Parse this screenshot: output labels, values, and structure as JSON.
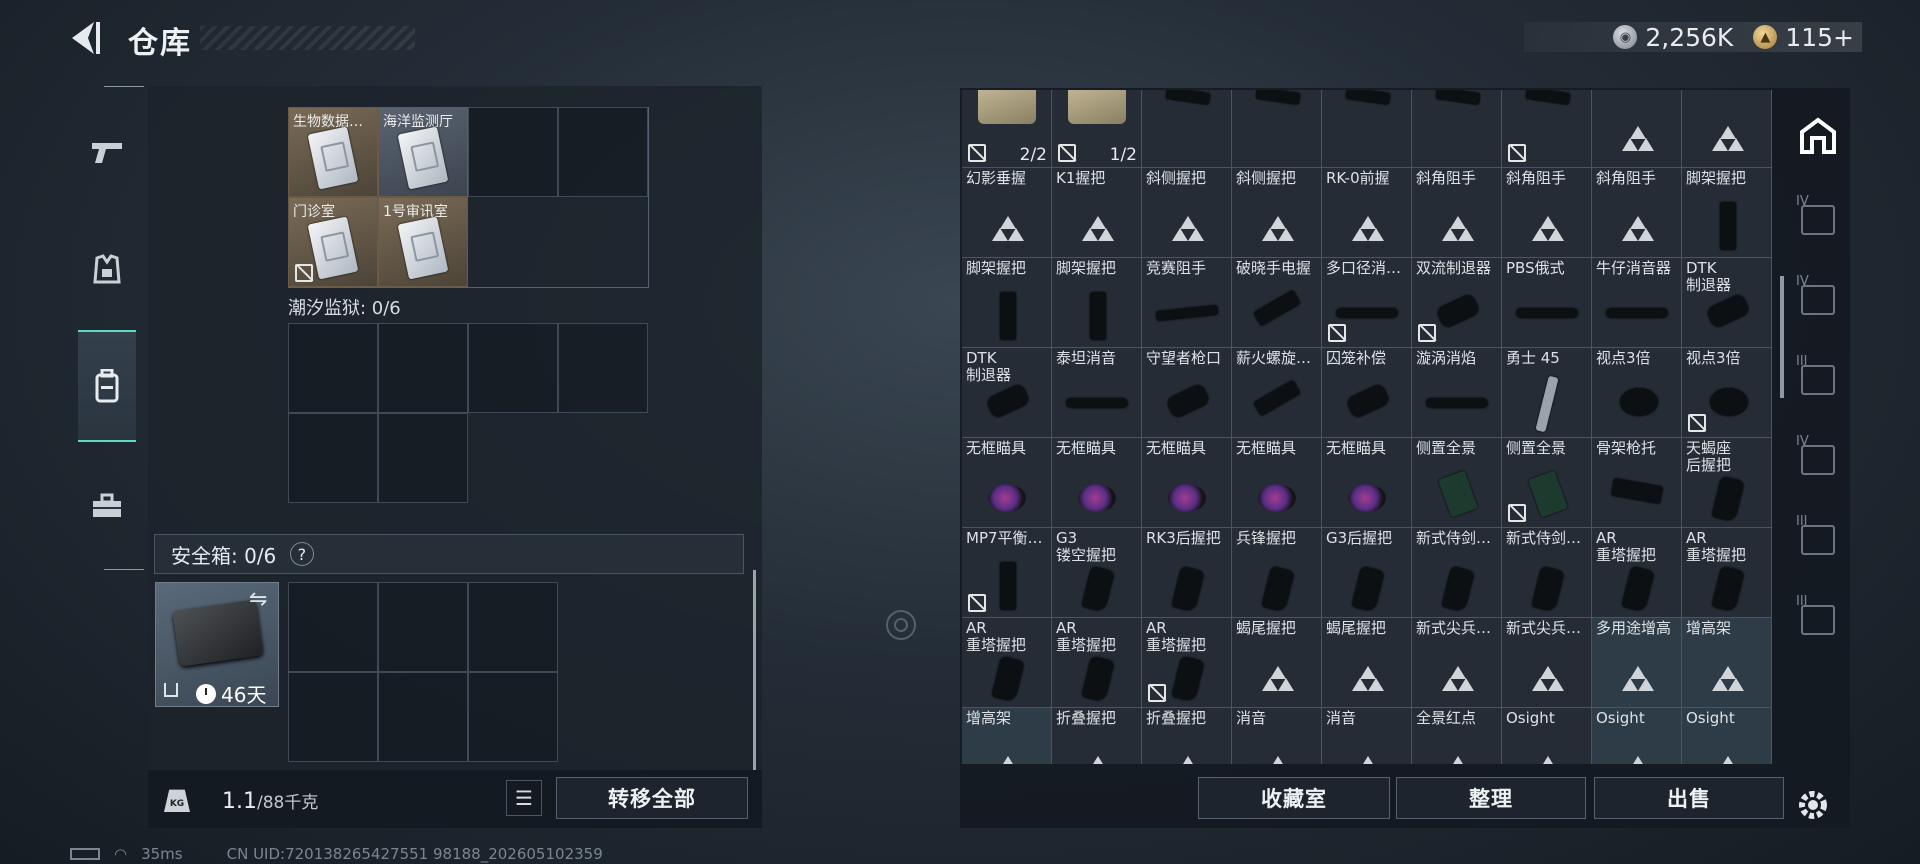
{
  "header": {
    "title": "仓库",
    "silver": "2,256K",
    "gold": "115+"
  },
  "left": {
    "docs": [
      {
        "label": "生物数据…",
        "blue": false,
        "nosale": false
      },
      {
        "label": "海洋监测厅",
        "blue": true,
        "nosale": false
      },
      {
        "label": "门诊室",
        "blue": false,
        "nosale": true
      },
      {
        "label": "1号审讯室",
        "blue": false,
        "nosale": false
      }
    ],
    "prison_label": "潮汐监狱: 0/6",
    "safe_label": "安全箱: 0/6",
    "safe_help": "?",
    "case_days": "46天",
    "weight_value": "1.1",
    "weight_max": "/88千克",
    "weight_icon": "KG",
    "transfer_all": "转移全部"
  },
  "status": {
    "ping": "35ms",
    "uid": "CN UID:720138265427551 98188_202605102359"
  },
  "right": {
    "buttons": {
      "collection": "收藏室",
      "sort": "整理",
      "sell": "出售"
    },
    "items": [
      {
        "name": "",
        "kind": "bag",
        "qty": "2/2",
        "nosale": true
      },
      {
        "name": "",
        "kind": "bag",
        "qty": "1/2",
        "nosale": true
      },
      {
        "name": "",
        "kind": "grip",
        "qty": "",
        "nosale": false
      },
      {
        "name": "",
        "kind": "grip",
        "qty": "",
        "nosale": false
      },
      {
        "name": "",
        "kind": "grip",
        "qty": "",
        "nosale": false
      },
      {
        "name": "",
        "kind": "grip",
        "qty": "",
        "nosale": false
      },
      {
        "name": "",
        "kind": "grip",
        "qty": "",
        "nosale": true
      },
      {
        "name": "",
        "kind": "tri",
        "qty": "",
        "nosale": false
      },
      {
        "name": "",
        "kind": "tri",
        "qty": "",
        "nosale": false
      },
      {
        "name": "幻影垂握",
        "kind": "tri"
      },
      {
        "name": "K1握把",
        "kind": "tri"
      },
      {
        "name": "斜侧握把",
        "kind": "tri"
      },
      {
        "name": "斜侧握把",
        "kind": "tri"
      },
      {
        "name": "RK-0前握",
        "kind": "tri"
      },
      {
        "name": "斜角阻手",
        "kind": "tri"
      },
      {
        "name": "斜角阻手",
        "kind": "tri"
      },
      {
        "name": "斜角阻手",
        "kind": "tri"
      },
      {
        "name": "脚架握把",
        "kind": "vgrip"
      },
      {
        "name": "脚架握把",
        "kind": "vgrip"
      },
      {
        "name": "脚架握把",
        "kind": "vgrip"
      },
      {
        "name": "竞赛阻手",
        "kind": "rail"
      },
      {
        "name": "破晓手电握",
        "kind": "light"
      },
      {
        "name": "多口径消…",
        "kind": "sup",
        "nosale": true
      },
      {
        "name": "双流制退器",
        "kind": "brake",
        "nosale": true
      },
      {
        "name": "PBS俄式",
        "kind": "sup"
      },
      {
        "name": "牛仔消音器",
        "kind": "sup"
      },
      {
        "name": "DTK\n制退器",
        "kind": "brake"
      },
      {
        "name": "DTK\n制退器",
        "kind": "brake"
      },
      {
        "name": "泰坦消音",
        "kind": "sup"
      },
      {
        "name": "守望者枪口",
        "kind": "brake"
      },
      {
        "name": "薪火螺旋…",
        "kind": "light"
      },
      {
        "name": "囚笼补偿",
        "kind": "brake"
      },
      {
        "name": "漩涡消焰",
        "kind": "sup"
      },
      {
        "name": "勇士 45",
        "kind": "blade"
      },
      {
        "name": "视点3倍",
        "kind": "optic"
      },
      {
        "name": "视点3倍",
        "kind": "optic",
        "nosale": true
      },
      {
        "name": "无框瞄具",
        "kind": "scope"
      },
      {
        "name": "无框瞄具",
        "kind": "scope"
      },
      {
        "name": "无框瞄具",
        "kind": "scope"
      },
      {
        "name": "无框瞄具",
        "kind": "scope"
      },
      {
        "name": "无框瞄具",
        "kind": "scope"
      },
      {
        "name": "侧置全景",
        "kind": "side"
      },
      {
        "name": "侧置全景",
        "kind": "side",
        "nosale": true
      },
      {
        "name": "骨架枪托",
        "kind": "stock"
      },
      {
        "name": "天蝎座\n后握把",
        "kind": "pgrip"
      },
      {
        "name": "MP7平衡…",
        "kind": "vgrip",
        "nosale": true
      },
      {
        "name": "G3\n镂空握把",
        "kind": "pgrip"
      },
      {
        "name": "RK3后握把",
        "kind": "pgrip"
      },
      {
        "name": "兵锋握把",
        "kind": "pgrip"
      },
      {
        "name": "G3后握把",
        "kind": "pgrip"
      },
      {
        "name": "新式侍剑…",
        "kind": "pgrip"
      },
      {
        "name": "新式侍剑…",
        "kind": "pgrip"
      },
      {
        "name": "AR\n重塔握把",
        "kind": "pgrip"
      },
      {
        "name": "AR\n重塔握把",
        "kind": "pgrip"
      },
      {
        "name": "AR\n重塔握把",
        "kind": "pgrip"
      },
      {
        "name": "AR\n重塔握把",
        "kind": "pgrip"
      },
      {
        "name": "AR\n重塔握把",
        "kind": "pgrip",
        "nosale": true
      },
      {
        "name": "蝎尾握把",
        "kind": "tri"
      },
      {
        "name": "蝎尾握把",
        "kind": "tri"
      },
      {
        "name": "新式尖兵…",
        "kind": "tri"
      },
      {
        "name": "新式尖兵…",
        "kind": "tri"
      },
      {
        "name": "多用途增高",
        "kind": "tri",
        "teal": true
      },
      {
        "name": "增高架",
        "kind": "tri",
        "teal": true
      },
      {
        "name": "增高架",
        "kind": "tri",
        "teal": true
      },
      {
        "name": "折叠握把",
        "kind": "tri"
      },
      {
        "name": "折叠握把",
        "kind": "tri"
      },
      {
        "name": "消音",
        "kind": "tri"
      },
      {
        "name": "消音",
        "kind": "tri"
      },
      {
        "name": "全景红点",
        "kind": "tri"
      },
      {
        "name": "Osight",
        "kind": "tri"
      },
      {
        "name": "Osight",
        "kind": "tri",
        "teal": true
      },
      {
        "name": "Osight",
        "kind": "tri",
        "teal": true
      }
    ]
  },
  "rtabs": [
    "",
    "IV",
    "IV",
    "III",
    "IV",
    "III",
    "III"
  ]
}
